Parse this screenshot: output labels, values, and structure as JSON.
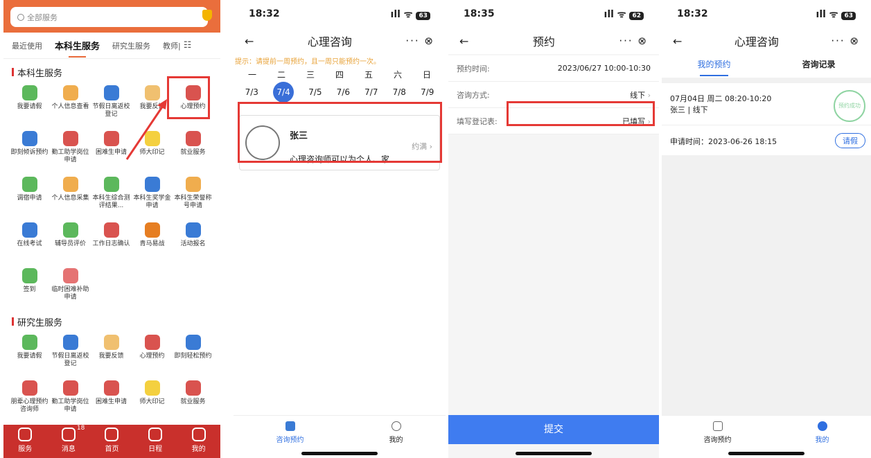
{
  "p1": {
    "search": "全部服务",
    "tabs": [
      "最近使用",
      "本科生服务",
      "研究生服务",
      "教师|"
    ],
    "sec1": "本科生服务",
    "ug": [
      {
        "l": "我要请假",
        "c": "#5cb85c"
      },
      {
        "l": "个人信息查看",
        "c": "#f0ad4e"
      },
      {
        "l": "节假日离返校登记",
        "c": "#3a7bd5"
      },
      {
        "l": "我要反馈",
        "c": "#f0c070"
      },
      {
        "l": "心理预约",
        "c": "#d9534f"
      },
      {
        "l": "即刻倾诉预约",
        "c": "#3a7bd5"
      },
      {
        "l": "勤工助学岗位申请",
        "c": "#d9534f"
      },
      {
        "l": "困难生申请",
        "c": "#d9534f"
      },
      {
        "l": "师大印记",
        "c": "#f4d03f"
      },
      {
        "l": "就业服务",
        "c": "#d9534f"
      },
      {
        "l": "调宿申请",
        "c": "#5cb85c"
      },
      {
        "l": "个人信息采集",
        "c": "#f0ad4e"
      },
      {
        "l": "本科生综合测评结果...",
        "c": "#5cb85c"
      },
      {
        "l": "本科生奖学金申请",
        "c": "#3a7bd5"
      },
      {
        "l": "本科生荣誉称号申请",
        "c": "#f0ad4e"
      },
      {
        "l": "在线考试",
        "c": "#3a7bd5"
      },
      {
        "l": "辅导员评价",
        "c": "#5cb85c"
      },
      {
        "l": "工作日志确认",
        "c": "#d9534f"
      },
      {
        "l": "青马易战",
        "c": "#e67e22"
      },
      {
        "l": "活动报名",
        "c": "#3a7bd5"
      },
      {
        "l": "签到",
        "c": "#5cb85c"
      },
      {
        "l": "临时困难补助申请",
        "c": "#e57373"
      }
    ],
    "sec2": "研究生服务",
    "pg": [
      {
        "l": "我要请假",
        "c": "#5cb85c"
      },
      {
        "l": "节假日离返校登记",
        "c": "#3a7bd5"
      },
      {
        "l": "我要反馈",
        "c": "#f0c070"
      },
      {
        "l": "心理预约",
        "c": "#d9534f"
      },
      {
        "l": "即刻轻松预约",
        "c": "#3a7bd5"
      },
      {
        "l": "朋辈心理预约咨询师",
        "c": "#d9534f"
      },
      {
        "l": "勤工助学岗位申请",
        "c": "#d9534f"
      },
      {
        "l": "困难生申请",
        "c": "#d9534f"
      },
      {
        "l": "师大印记",
        "c": "#f4d03f"
      },
      {
        "l": "就业服务",
        "c": "#d9534f"
      },
      {
        "l": "",
        "c": "#5cb85c"
      },
      {
        "l": "",
        "c": "#f0ad4e"
      },
      {
        "l": "",
        "c": "#5cb85c"
      },
      {
        "l": "",
        "c": "#3a7bd5"
      },
      {
        "l": "",
        "c": "#f0ad4e"
      }
    ],
    "bottom": [
      "服务",
      "消息",
      "首页",
      "日程",
      "我的"
    ],
    "msgcount": "18"
  },
  "p2": {
    "time": "18:32",
    "batt": "63",
    "title": "心理咨询",
    "tip": "提示：请提前一周预约，且一周只能预约一次。",
    "week": [
      "一",
      "二",
      "三",
      "四",
      "五",
      "六",
      "日"
    ],
    "dates": [
      "7/3",
      "7/4",
      "7/5",
      "7/6",
      "7/7",
      "7/8",
      "7/9"
    ],
    "name": "张三",
    "desc": "心理咨询师可以为个人、家...",
    "status": "约满",
    "tabs": [
      "咨询预约",
      "我的"
    ]
  },
  "p3": {
    "time": "18:35",
    "batt": "62",
    "title": "预约",
    "rows": [
      {
        "l": "预约时间:",
        "v": "2023/06/27 10:00-10:30"
      },
      {
        "l": "咨询方式:",
        "v": "线下"
      },
      {
        "l": "填写登记表:",
        "v": "已填写"
      }
    ],
    "submit": "提交"
  },
  "p4": {
    "time": "18:32",
    "batt": "63",
    "title": "心理咨询",
    "tabs": [
      "我的预约",
      "咨询记录"
    ],
    "date": "07月04日 周二 08:20-10:20",
    "who": "张三 | 线下",
    "apply": "申请时间：2023-06-26 18:15",
    "leave": "请假",
    "stamp": "预约成功",
    "bottom": [
      "咨询预约",
      "我的"
    ]
  }
}
